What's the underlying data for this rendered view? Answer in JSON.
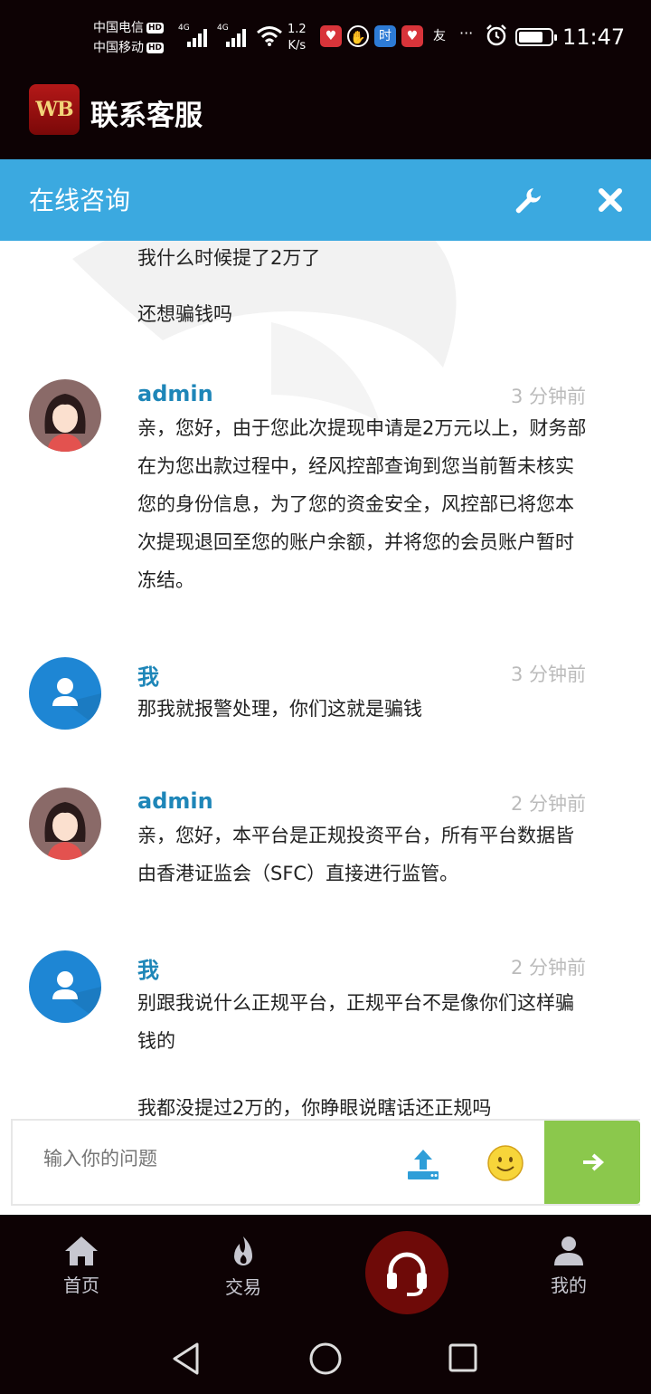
{
  "status_bar": {
    "carrier1": "中国电信",
    "carrier2": "中国移动",
    "hd_badge": "HD",
    "network": "4G",
    "speed_value": "1.2",
    "speed_unit": "K/s",
    "app_icons": [
      "heart-app-icon",
      "hand-app-icon",
      "time-app-icon",
      "heart-app-icon",
      "friend-app-icon"
    ],
    "app_glyph_time": "时",
    "app_glyph_friend": "友",
    "more": "···",
    "battery_level": 0.6,
    "time": "11:47"
  },
  "app_header": {
    "logo_text": "WB",
    "title": "联系客服"
  },
  "chat_header": {
    "title": "在线咨询",
    "settings_icon": "wrench-icon",
    "close_icon": "close-icon"
  },
  "messages": {
    "prev1": "我什么时候提了2万了",
    "prev2": "还想骗钱吗",
    "m1": {
      "sender": "admin",
      "time": "3 分钟前",
      "text": "亲，您好，由于您此次提现申请是2万元以上，财务部在为您出款过程中，经风控部查询到您当前暂未核实您的身份信息，为了您的资金安全，风控部已将您本次提现退回至您的账户余额，并将您的会员账户暂时冻结。"
    },
    "m2": {
      "sender": "我",
      "time": "3 分钟前",
      "text": "那我就报警处理，你们这就是骗钱"
    },
    "m3": {
      "sender": "admin",
      "time": "2 分钟前",
      "text": "亲，您好，本平台是正规投资平台，所有平台数据皆由香港证监会（SFC）直接进行监管。"
    },
    "m4": {
      "sender": "我",
      "time": "2 分钟前",
      "text": "别跟我说什么正规平台，正规平台不是像你们这样骗钱的",
      "text2": "我都没提过2万的，你睁眼说瞎话还正规吗"
    }
  },
  "input": {
    "placeholder": "输入你的问题",
    "upload_icon": "upload-icon",
    "emoji_icon": "emoji-icon",
    "send_icon": "arrow-right-icon"
  },
  "bottom_nav": {
    "home": "首页",
    "trade": "交易",
    "service_icon": "headset-icon",
    "mine": "我的"
  },
  "colors": {
    "header_bg": "#0d0204",
    "chat_header_bg": "#3ba9e0",
    "sender_name": "#1e86b8",
    "send_button": "#8bc84c",
    "service_button": "#6e0a08"
  }
}
